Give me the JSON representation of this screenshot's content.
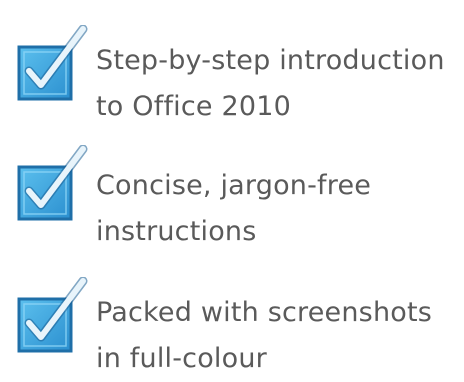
{
  "colors": {
    "box_fill": "#3aa8de",
    "box_border": "#1f6fa8",
    "check_stroke": "#e8f4fb",
    "text": "#5a5a5a"
  },
  "features": [
    {
      "icon": "checkbox-checked-icon",
      "line1": "Step-by-step introduction",
      "line2": "to Office 2010"
    },
    {
      "icon": "checkbox-checked-icon",
      "line1": "Concise, jargon-free",
      "line2": "instructions"
    },
    {
      "icon": "checkbox-checked-icon",
      "line1": "Packed with screenshots",
      "line2": "in full-colour"
    }
  ]
}
